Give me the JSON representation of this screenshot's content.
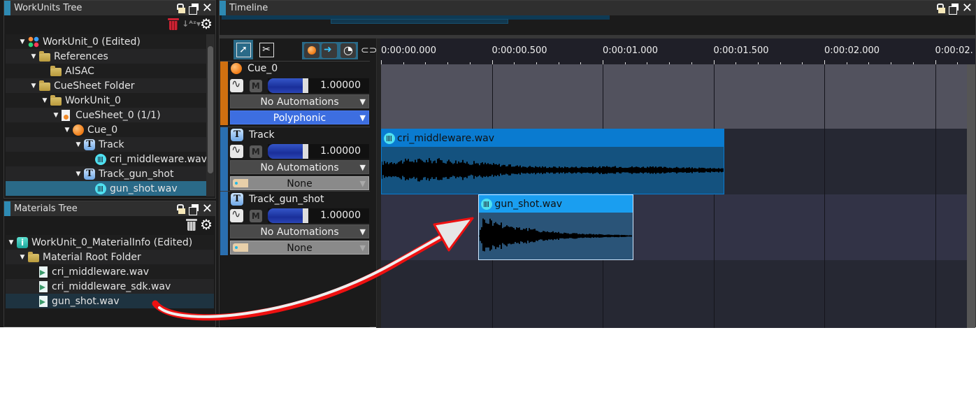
{
  "workunits_tree": {
    "title": "WorkUnits Tree",
    "items": [
      {
        "label": "WorkUnit_0 (Edited)",
        "icon": "workunit-icon",
        "depth": 0,
        "expanded": true
      },
      {
        "label": "References",
        "icon": "folder-open-icon",
        "depth": 1,
        "expanded": true
      },
      {
        "label": "AISAC",
        "icon": "folder-icon",
        "depth": 2,
        "expanded": null
      },
      {
        "label": "CueSheet Folder",
        "icon": "folder-open-icon",
        "depth": 1,
        "expanded": true
      },
      {
        "label": "WorkUnit_0",
        "icon": "folder-open-icon",
        "depth": 2,
        "expanded": true
      },
      {
        "label": "CueSheet_0 (1/1)",
        "icon": "cuesheet-icon",
        "depth": 3,
        "expanded": true
      },
      {
        "label": "Cue_0",
        "icon": "cue-icon",
        "depth": 4,
        "expanded": true
      },
      {
        "label": "Track",
        "icon": "track-icon",
        "depth": 5,
        "expanded": true
      },
      {
        "label": "cri_middleware.wav",
        "icon": "waveform-icon",
        "depth": 6,
        "expanded": null
      },
      {
        "label": "Track_gun_shot",
        "icon": "track-icon",
        "depth": 5,
        "expanded": true
      },
      {
        "label": "gun_shot.wav",
        "icon": "waveform-icon",
        "depth": 6,
        "expanded": null,
        "selected": true
      }
    ]
  },
  "materials_tree": {
    "title": "Materials Tree",
    "items": [
      {
        "label": "WorkUnit_0_MaterialInfo (Edited)",
        "icon": "info-icon",
        "depth": 0,
        "expanded": true
      },
      {
        "label": "Material Root Folder",
        "icon": "folder-open-icon",
        "depth": 1,
        "expanded": true
      },
      {
        "label": "cri_middleware.wav",
        "icon": "material-file-icon",
        "depth": 2,
        "expanded": null
      },
      {
        "label": "cri_middleware_sdk.wav",
        "icon": "material-file-icon",
        "depth": 2,
        "expanded": null
      },
      {
        "label": "gun_shot.wav",
        "icon": "material-file-icon",
        "depth": 2,
        "expanded": null,
        "selected": true
      }
    ]
  },
  "timeline": {
    "title": "Timeline",
    "ruler_labels": [
      "0:00:00.000",
      "0:00:00.500",
      "0:00:01.000",
      "0:00:01.500",
      "0:00:02.000",
      "0:00:02."
    ],
    "strips": [
      {
        "name": "Cue_0",
        "type": "cue",
        "volume_text": "1.00000",
        "volume": 1.0,
        "automation": "No Automations",
        "mode": "Polyphonic",
        "color": "#d07010"
      },
      {
        "name": "Track",
        "type": "track",
        "volume_text": "1.00000",
        "volume": 1.0,
        "automation": "No Automations",
        "mode": "None",
        "color": "#2a6fb0"
      },
      {
        "name": "Track_gun_shot",
        "type": "track",
        "volume_text": "1.00000",
        "volume": 1.0,
        "automation": "No Automations",
        "mode": "None",
        "color": "#2a6fb0"
      }
    ],
    "clips": [
      {
        "name": "cri_middleware.wav",
        "lane": 1,
        "start_s": 0.0,
        "end_s": 1.55
      },
      {
        "name": "gun_shot.wav",
        "lane": 2,
        "start_s": 0.44,
        "end_s": 1.14
      }
    ],
    "mute_label": "M"
  },
  "colors": {
    "accent": "#2e8ab3",
    "cue_strip": "#d07010",
    "track_strip": "#2a6fb0",
    "clip_head_1": "#0a7bd0",
    "clip_head_2": "#1a9ef0",
    "annotation_arrow": "#ee1111"
  }
}
